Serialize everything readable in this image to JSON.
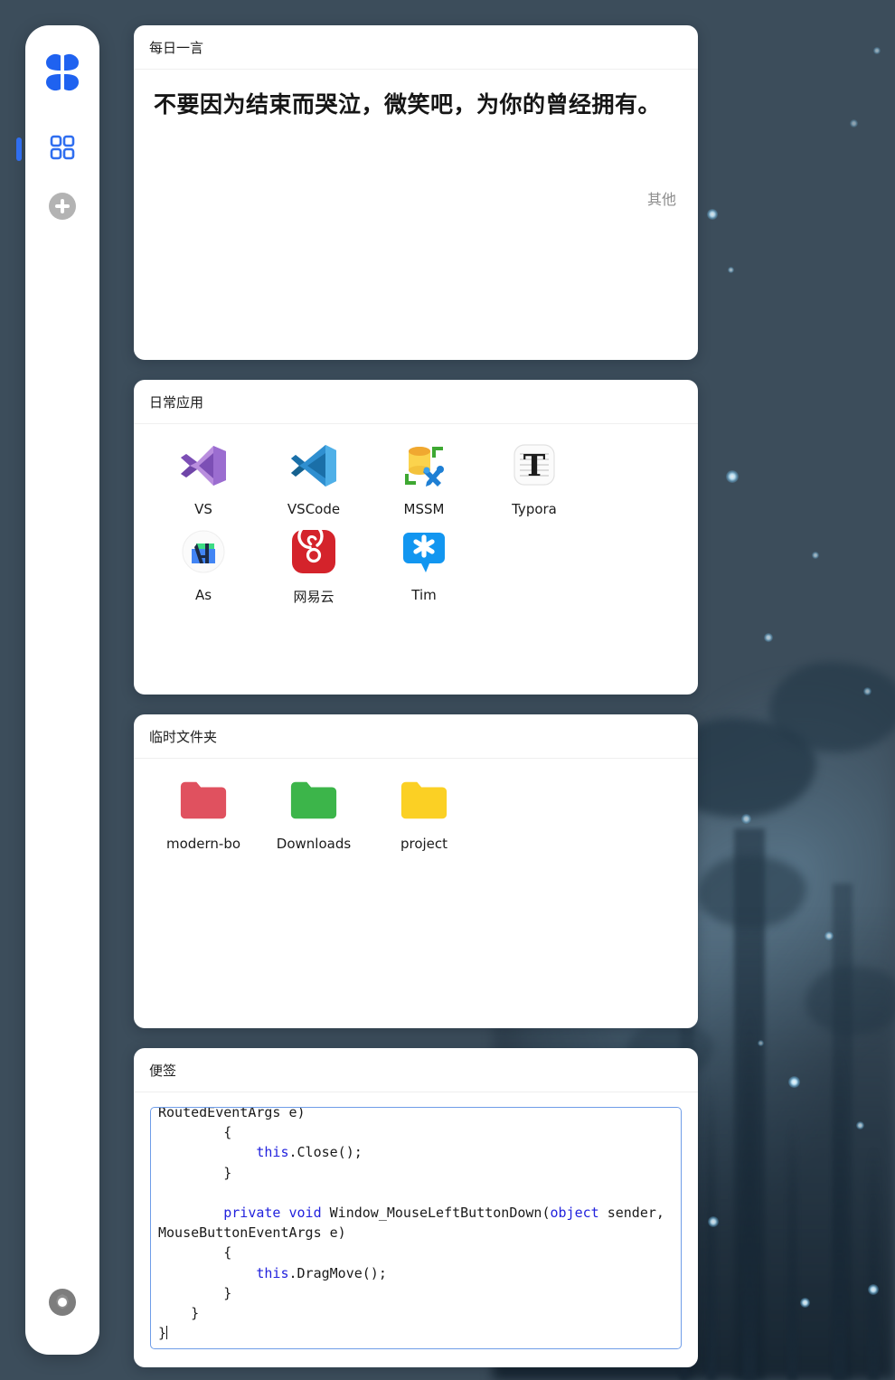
{
  "wallpaper": {
    "description": "misty blue forest with fireflies",
    "base_color": "#3b4b58",
    "glow_color": "#8cc8ea"
  },
  "sidebar": {
    "logo": {
      "name": "app-logo",
      "icon": "four-petal-logo-icon",
      "color": "#1f62f0"
    },
    "items": [
      {
        "label": "",
        "icon": "grid-apps-icon",
        "active": true
      }
    ],
    "add_button": {
      "icon": "plus-circle-icon",
      "label": ""
    },
    "settings_button": {
      "icon": "gear-icon",
      "label": ""
    },
    "accent_color": "#2f6ef0"
  },
  "cards": {
    "quote": {
      "title": "每日一言",
      "text": "不要因为结束而哭泣，微笑吧，为你的曾经拥有。",
      "source": "其他"
    },
    "apps": {
      "title": "日常应用",
      "items": [
        {
          "label": "VS",
          "icon": "visual-studio-icon"
        },
        {
          "label": "VSCode",
          "icon": "vscode-icon"
        },
        {
          "label": "MSSM",
          "icon": "sql-server-management-studio-icon"
        },
        {
          "label": "Typora",
          "icon": "typora-icon"
        },
        {
          "label": "As",
          "icon": "android-studio-icon"
        },
        {
          "label": "网易云",
          "icon": "netease-music-icon"
        },
        {
          "label": "Tim",
          "icon": "tim-icon"
        }
      ]
    },
    "folders": {
      "title": "临时文件夹",
      "items": [
        {
          "label": "modern-bo",
          "icon": "folder-icon",
          "color": "#e0515f"
        },
        {
          "label": "Downloads",
          "icon": "folder-icon",
          "color": "#3cb54a"
        },
        {
          "label": "project",
          "icon": "folder-icon",
          "color": "#fbd024"
        }
      ]
    },
    "notes": {
      "title": "便签",
      "code_lines": [
        {
          "indent": 0,
          "clipped": true,
          "parts": [
            {
              "t": "RoutedEventArgs e)",
              "k": false
            }
          ]
        },
        {
          "indent": 8,
          "parts": [
            {
              "t": "{",
              "k": false
            }
          ]
        },
        {
          "indent": 12,
          "parts": [
            {
              "t": "this",
              "k": true
            },
            {
              "t": ".Close();",
              "k": false
            }
          ]
        },
        {
          "indent": 8,
          "parts": [
            {
              "t": "}",
              "k": false
            }
          ]
        },
        {
          "indent": 0,
          "parts": [
            {
              "t": "",
              "k": false
            }
          ]
        },
        {
          "indent": 8,
          "parts": [
            {
              "t": "private void ",
              "k": true
            },
            {
              "t": "Window_MouseLeftButtonDown(",
              "k": false
            },
            {
              "t": "object",
              "k": true
            },
            {
              "t": " sender, MouseButtonEventArgs e)",
              "k": false
            }
          ]
        },
        {
          "indent": 8,
          "parts": [
            {
              "t": "{",
              "k": false
            }
          ]
        },
        {
          "indent": 12,
          "parts": [
            {
              "t": "this",
              "k": true
            },
            {
              "t": ".DragMove();",
              "k": false
            }
          ]
        },
        {
          "indent": 8,
          "parts": [
            {
              "t": "}",
              "k": false
            }
          ]
        },
        {
          "indent": 4,
          "parts": [
            {
              "t": "}",
              "k": false
            }
          ]
        },
        {
          "indent": 0,
          "caret": true,
          "parts": [
            {
              "t": "}",
              "k": false
            }
          ]
        }
      ],
      "border_color": "#6f9de8"
    }
  }
}
